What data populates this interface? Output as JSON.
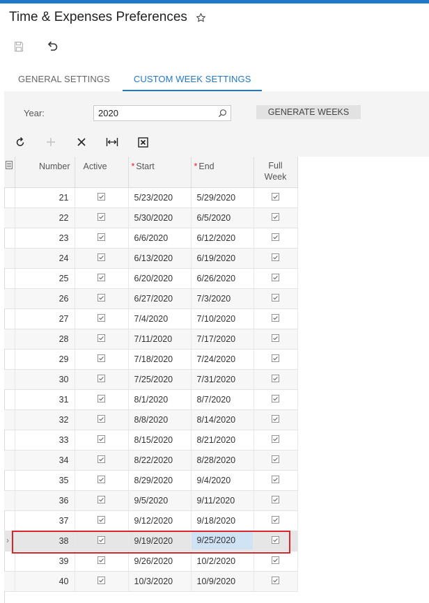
{
  "page": {
    "title": "Time & Expenses Preferences"
  },
  "tabs": [
    {
      "label": "GENERAL SETTINGS",
      "active": false
    },
    {
      "label": "CUSTOM WEEK SETTINGS",
      "active": true
    }
  ],
  "form": {
    "year_label": "Year:",
    "year_value": "2020",
    "generate_button": "GENERATE WEEKS"
  },
  "grid": {
    "columns": {
      "number": "Number",
      "active": "Active",
      "start": "Start",
      "end": "End",
      "full_week": "Full Week"
    },
    "rows": [
      {
        "number": "21",
        "start": "5/23/2020",
        "end": "5/29/2020"
      },
      {
        "number": "22",
        "start": "5/30/2020",
        "end": "6/5/2020"
      },
      {
        "number": "23",
        "start": "6/6/2020",
        "end": "6/12/2020"
      },
      {
        "number": "24",
        "start": "6/13/2020",
        "end": "6/19/2020"
      },
      {
        "number": "25",
        "start": "6/20/2020",
        "end": "6/26/2020"
      },
      {
        "number": "26",
        "start": "6/27/2020",
        "end": "7/3/2020"
      },
      {
        "number": "27",
        "start": "7/4/2020",
        "end": "7/10/2020"
      },
      {
        "number": "28",
        "start": "7/11/2020",
        "end": "7/17/2020"
      },
      {
        "number": "29",
        "start": "7/18/2020",
        "end": "7/24/2020"
      },
      {
        "number": "30",
        "start": "7/25/2020",
        "end": "7/31/2020"
      },
      {
        "number": "31",
        "start": "8/1/2020",
        "end": "8/7/2020"
      },
      {
        "number": "32",
        "start": "8/8/2020",
        "end": "8/14/2020"
      },
      {
        "number": "33",
        "start": "8/15/2020",
        "end": "8/21/2020"
      },
      {
        "number": "34",
        "start": "8/22/2020",
        "end": "8/28/2020"
      },
      {
        "number": "35",
        "start": "8/29/2020",
        "end": "9/4/2020"
      },
      {
        "number": "36",
        "start": "9/5/2020",
        "end": "9/11/2020"
      },
      {
        "number": "37",
        "start": "9/12/2020",
        "end": "9/18/2020"
      },
      {
        "number": "38",
        "start": "9/19/2020",
        "end": "9/25/2020",
        "selected": true
      },
      {
        "number": "39",
        "start": "9/26/2020",
        "end": "10/2/2020"
      },
      {
        "number": "40",
        "start": "10/3/2020",
        "end": "10/9/2020"
      }
    ]
  },
  "colors": {
    "accent": "#1f78c8",
    "highlight_border": "#d9262a",
    "selected_cell": "#cfe3f5"
  },
  "icons": {
    "favorite": "star-outline-icon",
    "save": "save-icon",
    "undo": "undo-icon",
    "refresh": "refresh-icon",
    "add": "plus-icon",
    "delete": "close-icon",
    "fit": "fit-width-icon",
    "export": "excel-export-icon",
    "search": "search-icon"
  }
}
